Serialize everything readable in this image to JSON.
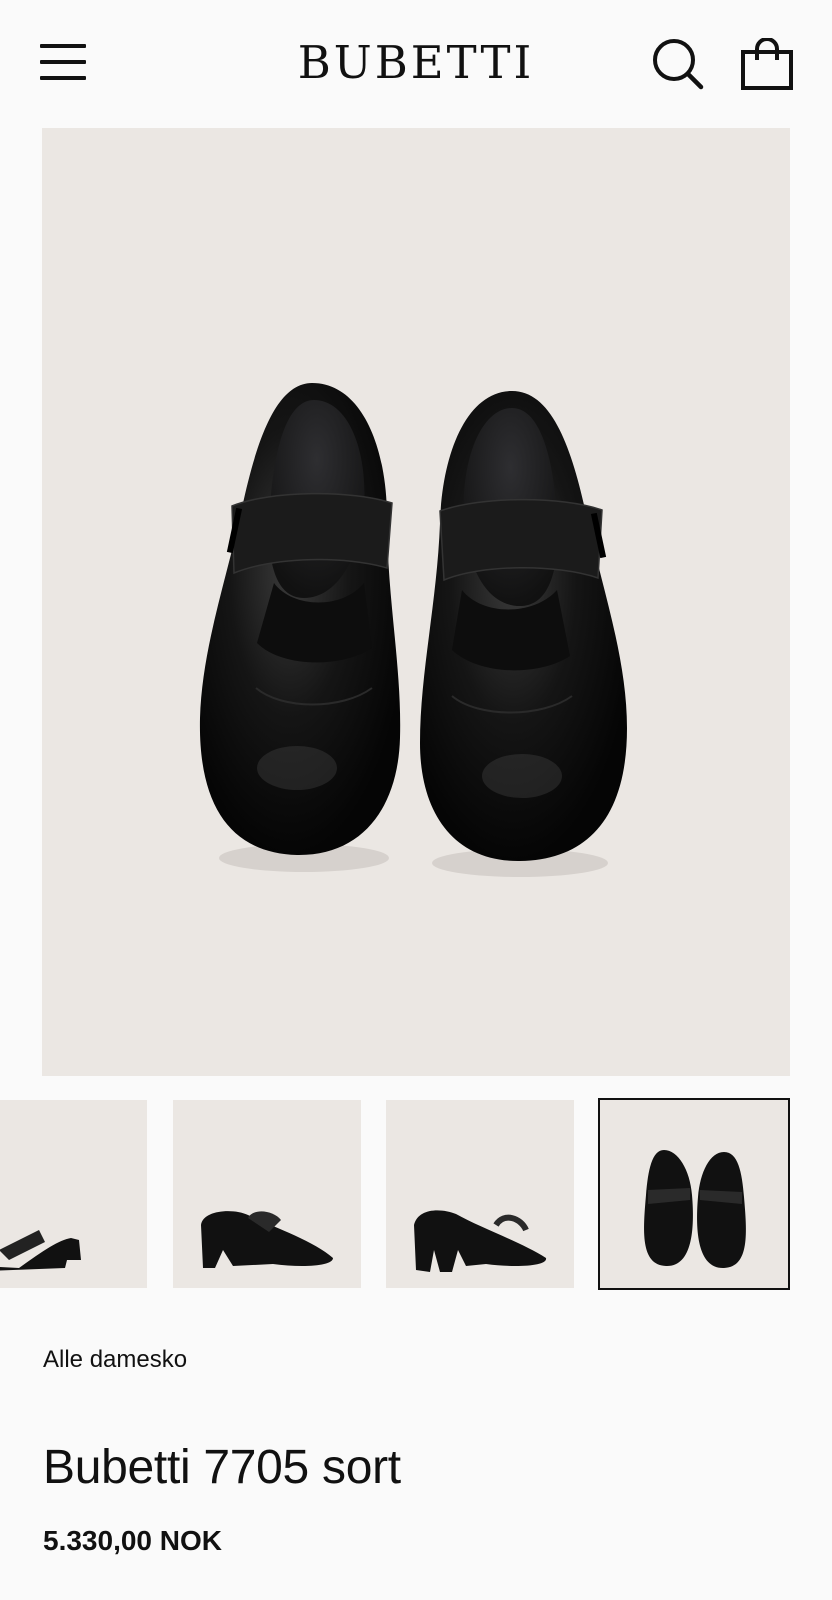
{
  "header": {
    "brand": "BUBETTI",
    "menu_icon": "hamburger-menu-icon",
    "search_icon": "search-icon",
    "cart_icon": "shopping-bag-icon"
  },
  "gallery": {
    "main_image": "black-leather-mary-jane-shoes-top-view",
    "thumbnails": [
      {
        "image": "shoe-side-view"
      },
      {
        "image": "shoe-front-three-quarter-view"
      },
      {
        "image": "shoe-back-three-quarter-view"
      },
      {
        "image": "shoe-top-view",
        "active": true
      }
    ]
  },
  "product": {
    "breadcrumb": "Alle damesko",
    "title": "Bubetti 7705 sort",
    "price": "5.330,00 NOK"
  },
  "colors": {
    "background": "#fafafa",
    "image_background": "#ebe7e3",
    "text": "#111111"
  }
}
